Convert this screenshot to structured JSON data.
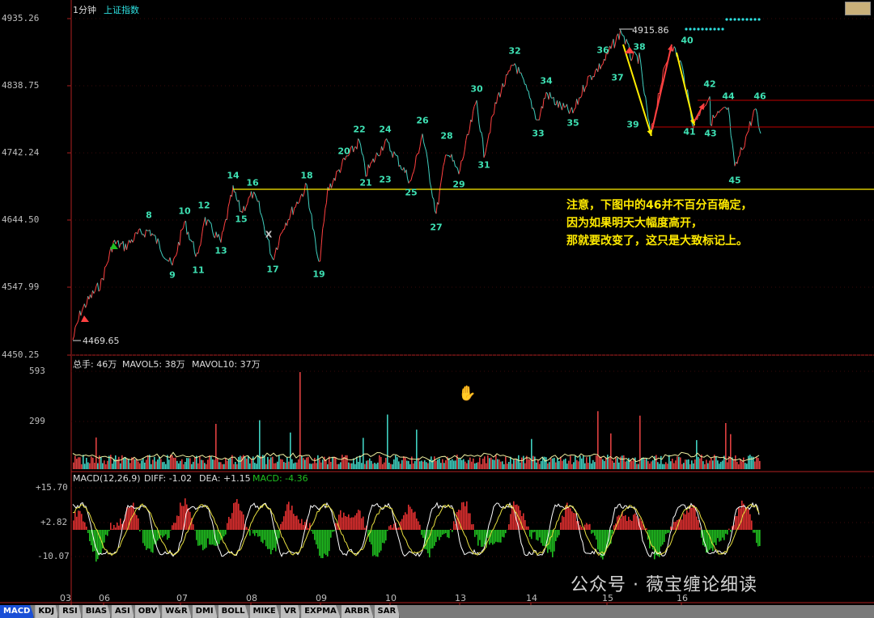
{
  "header": {
    "period": "1分钟",
    "index_name": "上证指数"
  },
  "price_panel": {
    "y_ticks": [
      "4935.26",
      "4838.75",
      "4742.24",
      "4644.50",
      "4547.99",
      "4450.25"
    ],
    "high_label": "4915.86",
    "low_label": "4469.65"
  },
  "volume_panel": {
    "header_total": "总手: 46万",
    "header_ma5": "MAVOL5: 38万",
    "header_ma10": "MAVOL10: 37万",
    "y_ticks": [
      "593",
      "299"
    ]
  },
  "macd_panel": {
    "header_name": "MACD(12,26,9)",
    "header_diff": "DIFF: -1.02",
    "header_dea": "DEA: +1.15",
    "header_macd": "MACD: -4.36",
    "y_ticks": [
      "+15.70",
      "+2.82",
      "-10.07"
    ]
  },
  "x_axis": {
    "ticks": [
      "03",
      "06",
      "07",
      "08",
      "09",
      "10",
      "13",
      "14",
      "15",
      "16"
    ]
  },
  "annotation_note": {
    "line1": "注意，下图中的46并不百分百确定，",
    "line2": "因为如果明天大幅度高开，",
    "line3": "那就要改变了，这只是大致标记上。"
  },
  "wave_labels": [
    "8",
    "9",
    "10",
    "11",
    "12",
    "13",
    "14",
    "15",
    "16",
    "17",
    "18",
    "19",
    "20",
    "21",
    "22",
    "23",
    "24",
    "25",
    "26",
    "27",
    "28",
    "29",
    "30",
    "31",
    "32",
    "33",
    "34",
    "35",
    "36",
    "37",
    "38",
    "39",
    "40",
    "41",
    "42",
    "43",
    "44",
    "45",
    "46",
    "X"
  ],
  "tabs": [
    "MACD",
    "KDJ",
    "RSI",
    "BIAS",
    "ASI",
    "OBV",
    "W&R",
    "DMI",
    "BOLL",
    "MIKE",
    "VR",
    "EXPMA",
    "ARBR",
    "SAR"
  ],
  "watermark": "公众号 · 薇宝缠论细读",
  "colors": {
    "up": "#ff4040",
    "down": "#40d0c0",
    "wave_label": "#3ee0b3",
    "support_line": "#ffee00",
    "annotation_arrow": "#ffee00",
    "resistance_line": "#c00000",
    "macd_pos": "#e03030",
    "macd_neg": "#20c020"
  },
  "chart_data": {
    "type": "line",
    "title": "上证指数",
    "ylim": [
      4450.25,
      4935.26
    ],
    "key_points": {
      "start_low": 4469.65,
      "peak_high": 4915.86,
      "support_level": 4690,
      "resistance_level_1": 4800,
      "resistance_level_2": 4767
    }
  }
}
